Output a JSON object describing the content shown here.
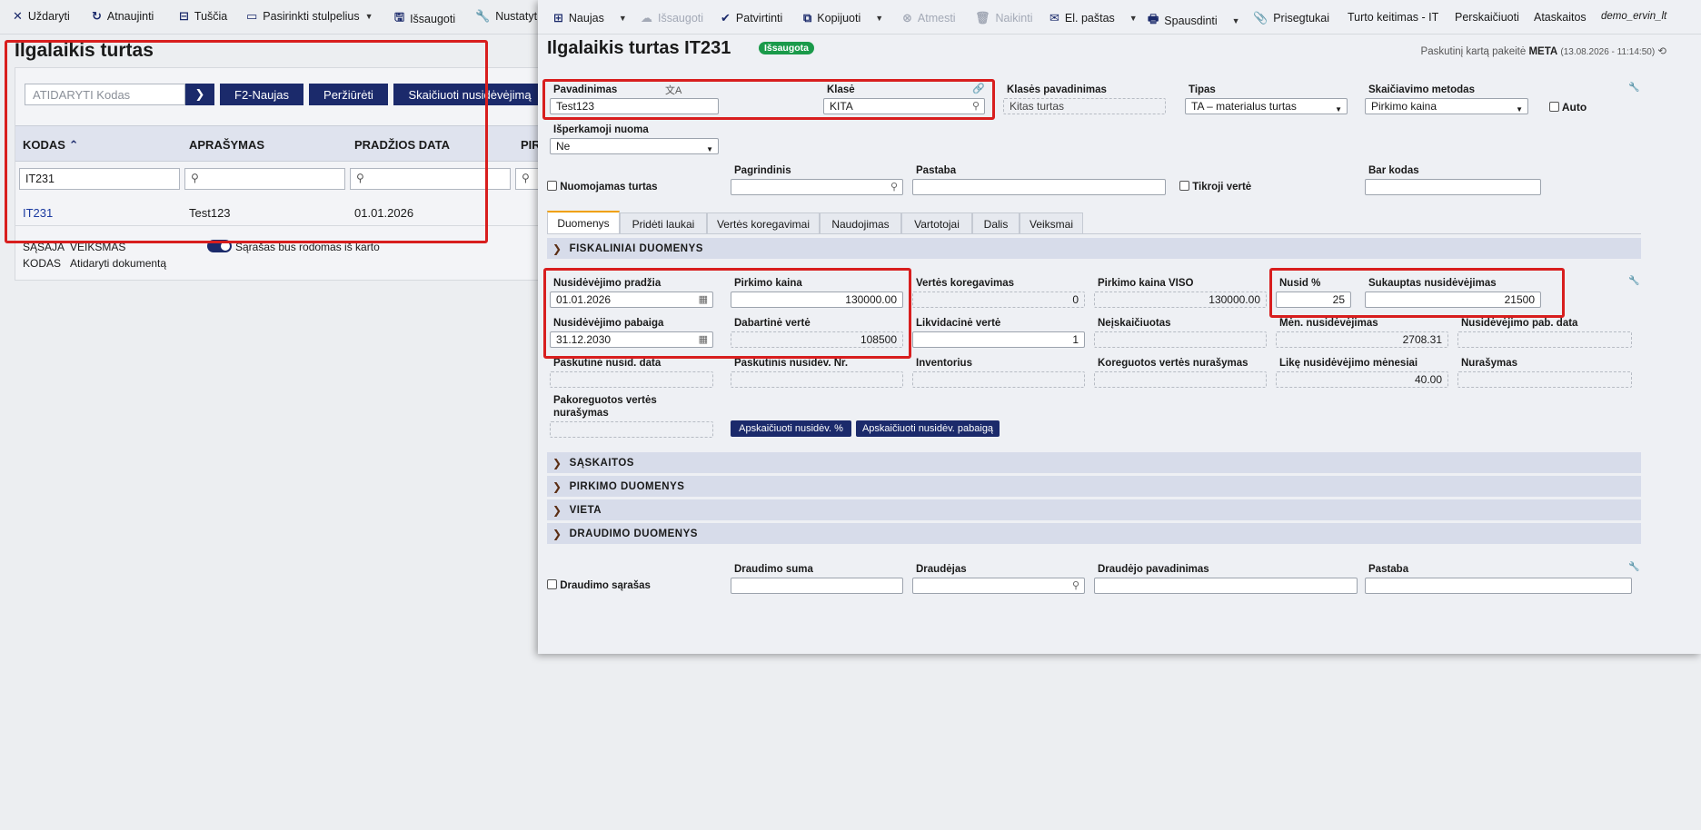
{
  "bg_toolbar": {
    "close": "Uždaryti",
    "refresh": "Atnaujinti",
    "empty": "Tuščia",
    "choose_columns": "Pasirinkti stulpelius",
    "save": "Išsaugoti",
    "settings": "Nustatyt"
  },
  "list": {
    "title": "Ilgalaikis turtas",
    "search_placeholder": "ATIDARYTI Kodas",
    "btn_new": "F2-Naujas",
    "btn_view": "Peržiūrėti",
    "btn_calc": "Skaičiuoti nusidėvėjimą",
    "columns": [
      "KODAS",
      "APRAŠYMAS",
      "PRADŽIOS DATA",
      "PIR"
    ],
    "filter_code": "IT231",
    "rows": [
      {
        "code": "IT231",
        "desc": "Test123",
        "start": "01.01.2026"
      }
    ],
    "legend_1_key": "SĄSAJA",
    "legend_1_val": "VEIKSMAS",
    "legend_2_key": "KODAS",
    "legend_2_val": "Atidaryti dokumentą",
    "toggle_label": "Sąrašas bus rodomas iš karto"
  },
  "toolbar": {
    "new": "Naujas",
    "save": "Išsaugoti",
    "confirm": "Patvirtinti",
    "copy": "Kopijuoti",
    "reject": "Atmesti",
    "delete": "Naikinti",
    "email": "El. paštas",
    "print": "Spausdinti",
    "attachments": "Prisegtukai",
    "rate_change": "Turto keitimas - IT",
    "recalc": "Perskaičiuoti",
    "reports": "Ataskaitos",
    "user": "demo_ervin_lt"
  },
  "form": {
    "title": "Ilgalaikis turtas IT231",
    "status": "Išsaugota",
    "modified_prefix": "Paskutinį kartą pakeitė",
    "modified_user": "META",
    "modified_time": "(13.08.2026 - 11:14:50)",
    "name_label": "Pavadinimas",
    "name_value": "Test123",
    "class_label": "Klasė",
    "class_value": "KITA",
    "class_name_label": "Klasės pavadinimas",
    "class_name_value": "Kitas turtas",
    "type_label": "Tipas",
    "type_value": "TA – materialus turtas",
    "method_label": "Skaičiavimo metodas",
    "method_value": "Pirkimo kaina",
    "auto_label": "Auto",
    "lease_label": "Išperkamoji nuoma",
    "lease_value": "Ne",
    "rented_label": "Nuomojamas turtas",
    "main_label": "Pagrindinis",
    "note_label": "Pastaba",
    "real_value_label": "Tikroji vertė",
    "barcode_label": "Bar kodas"
  },
  "tabs": [
    "Duomenys",
    "Pridėti laukai",
    "Vertės koregavimai",
    "Naudojimas",
    "Vartotojai",
    "Dalis",
    "Veiksmai"
  ],
  "fiscal": {
    "section": "FISKALINIAI DUOMENYS",
    "dep_start_label": "Nusidėvėjimo pradžia",
    "dep_start_value": "01.01.2026",
    "purchase_price_label": "Pirkimo kaina",
    "purchase_price_value": "130000.00",
    "value_adj_label": "Vertės koregavimas",
    "value_adj_value": "0",
    "purchase_viso_label": "Pirkimo kaina VISO",
    "purchase_viso_value": "130000.00",
    "dep_pct_label": "Nusid %",
    "dep_pct_value": "25",
    "accum_dep_label": "Sukauptas nusidėvėjimas",
    "accum_dep_value": "21500",
    "dep_end_label": "Nusidėvėjimo pabaiga",
    "dep_end_value": "31.12.2030",
    "current_value_label": "Dabartinė vertė",
    "current_value_value": "108500",
    "liquid_label": "Likvidacinė vertė",
    "liquid_value": "1",
    "not_calc_label": "Neįskaičiuotas",
    "monthly_label": "Mėn. nusidėvėjimas",
    "monthly_value": "2708.31",
    "dep_end_date_label": "Nusidėvėjimo pab. data",
    "last_date_label": "Paskutinė nusid. data",
    "last_nr_label": "Paskutinis nusidėv. Nr.",
    "inventory_label": "Inventorius",
    "adj_writeoff_label": "Koreguotos vertės nurašymas",
    "months_left_label": "Likę nusidėvėjimo mėnesiai",
    "months_left_value": "40.00",
    "writeoff_label": "Nurašymas",
    "post_adj_label_1": "Pakoreguotos vertės",
    "post_adj_label_2": "nurašymas",
    "btn_calc_pct": "Apskaičiuoti nusidėv. %",
    "btn_calc_end": "Apskaičiuoti nusidėv. pabaigą"
  },
  "sections": [
    "SĄSKAITOS",
    "PIRKIMO DUOMENYS",
    "VIETA",
    "DRAUDIMO DUOMENYS"
  ],
  "insurance": {
    "list_label": "Draudimo sąrašas",
    "sum_label": "Draudimo suma",
    "insurer_label": "Draudėjas",
    "insurer_name_label": "Draudėjo pavadinimas",
    "note_label": "Pastaba"
  },
  "colors": {
    "accent": "#1b2a6b",
    "highlight": "#d81e1e",
    "status": "#1a9a4a"
  }
}
